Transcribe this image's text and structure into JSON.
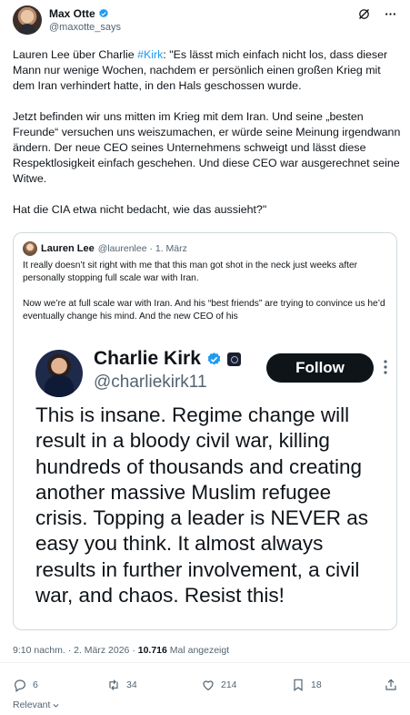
{
  "author": {
    "name": "Max Otte",
    "handle": "@maxotte_says"
  },
  "header_icons": [
    "grok-icon",
    "more-icon"
  ],
  "tweet": {
    "p1_prefix": "Lauren Lee über Charlie ",
    "p1_hashtag": "#Kirk",
    "p1_suffix": ": \"Es lässt mich einfach nicht los, dass dieser Mann nur wenige Wochen, nachdem er persönlich einen großen Krieg mit dem Iran verhindert hatte, in den Hals geschossen wurde.",
    "p2": "Jetzt befinden wir uns mitten im Krieg mit dem Iran. Und seine „besten Freunde“ versuchen uns weiszumachen, er würde seine Meinung irgendwann ändern. Der neue CEO seines Unternehmens schweigt und lässt diese Respektlosigkeit einfach geschehen. Und diese CEO war ausgerechnet seine Witwe.",
    "p3": "Hat die CIA etwa nicht bedacht, wie das aussieht?\""
  },
  "quote": {
    "name": "Lauren Lee",
    "meta": "@laurenlee · 1. März",
    "p1": "It really doesn’t sit right with me that this man got shot in the neck just weeks after personally stopping full scale war with Iran.",
    "p2": "Now we’re at full scale war with Iran. And his “best friends” are trying to convince us he’d eventually change his mind. And the new CEO of his",
    "embed": {
      "name": "Charlie Kirk",
      "handle": "@charliekirk11",
      "follow_label": "Follow",
      "text": "This is insane. Regime change will result in a bloody civil war, killing hundreds of thousands and creating another massive Muslim refugee crisis. Topping a leader is NEVER as easy you think. It almost always results in further involvement, a civil war, and chaos. Resist this!"
    }
  },
  "timestamp": {
    "time_date": "9:10 nachm. · 2. März 2026 · ",
    "views": "10.716",
    "views_label": " Mal angezeigt"
  },
  "actions": {
    "replies": "6",
    "reposts": "34",
    "likes": "214",
    "bookmarks": "18"
  },
  "sort": {
    "label": "Relevant"
  },
  "colors": {
    "accent": "#1d9bf0",
    "text": "#0f1419",
    "muted": "#536471",
    "border": "#cfd9de"
  }
}
